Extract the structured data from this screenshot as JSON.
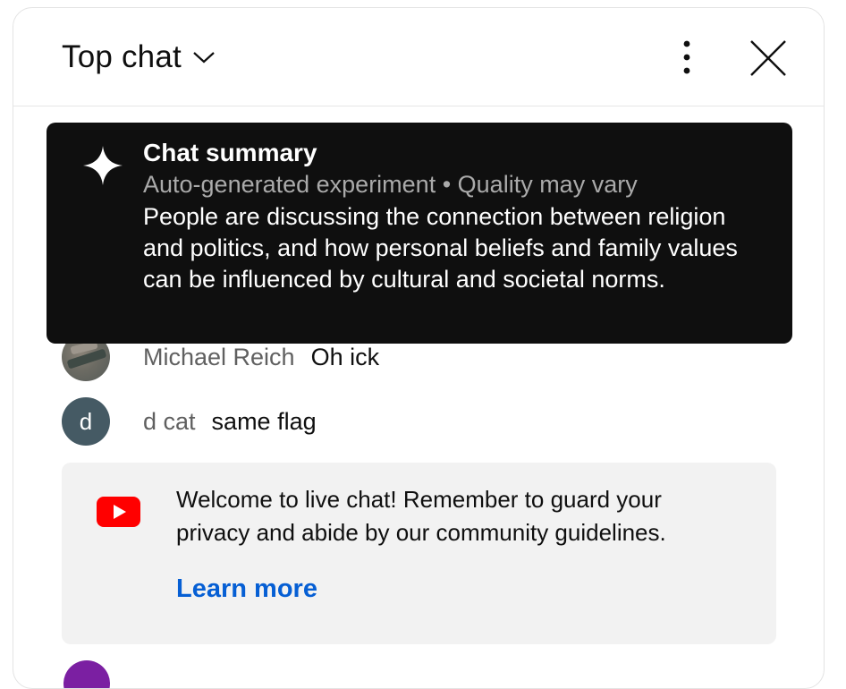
{
  "header": {
    "mode_label": "Top chat",
    "mode_icon": "chevron-down-icon",
    "more_icon": "more-vertical-icon",
    "close_icon": "close-icon"
  },
  "summary": {
    "icon": "sparkle-icon",
    "title": "Chat summary",
    "disclaimer": "Auto-generated experiment • Quality may vary",
    "body": "People are discussing the connection between religion and politics, and how personal beliefs and family values can be influenced by cultural and societal norms."
  },
  "messages": [
    {
      "author": "Michael Reich",
      "text": "Oh ick",
      "avatar": "photo"
    },
    {
      "author": "d cat",
      "text": "same flag",
      "avatar_letter": "d",
      "avatar_color": "#455a64"
    }
  ],
  "welcome": {
    "icon": "youtube-icon",
    "text": "Welcome to live chat! Remember to guard your privacy and abide by our community guidelines.",
    "link": "Learn more"
  },
  "colors": {
    "summary_bg": "#0f0f0f",
    "link": "#065fd4",
    "youtube_red": "#ff0000",
    "welcome_bg": "#f2f2f2",
    "bottom_avatar": "#7b1fa2"
  }
}
